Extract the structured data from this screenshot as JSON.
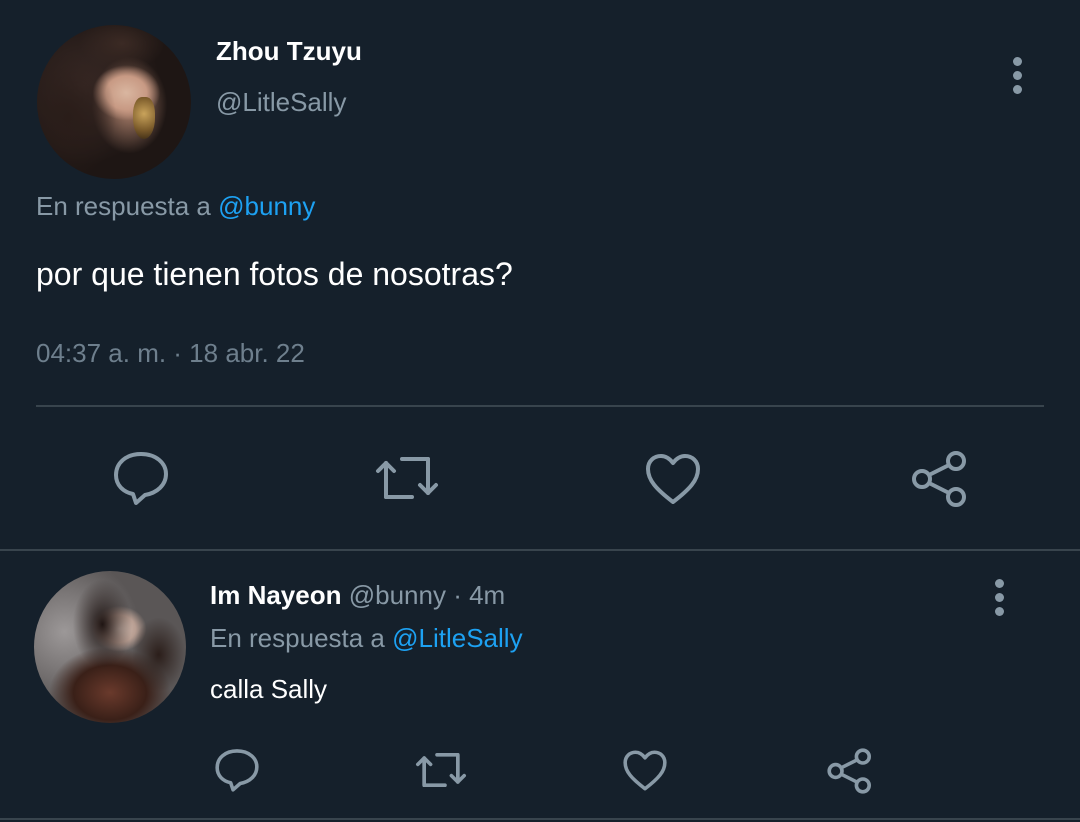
{
  "main_tweet": {
    "author_name": "Zhou Tzuyu",
    "author_handle": "@LitleSally",
    "reply_prefix": "En respuesta a ",
    "reply_mention": "@bunny",
    "text": "por que tienen fotos de nosotras?",
    "timestamp": "04:37 a. m. · 18 abr. 22",
    "actions": [
      "reply-icon",
      "retweet-icon",
      "like-icon",
      "share-icon"
    ]
  },
  "reply_tweet": {
    "author_name": "Im Nayeon",
    "author_handle": "@bunny",
    "separator": " · ",
    "time_ago": "4m",
    "reply_prefix": "En respuesta a ",
    "reply_mention": "@LitleSally",
    "text": "calla Sally",
    "actions": [
      "reply-icon",
      "retweet-icon",
      "like-icon",
      "share-icon"
    ]
  },
  "colors": {
    "background": "#15202b",
    "text_primary": "#ffffff",
    "text_secondary": "#8899a6",
    "mention": "#1da1f2",
    "divider": "#38444d"
  }
}
